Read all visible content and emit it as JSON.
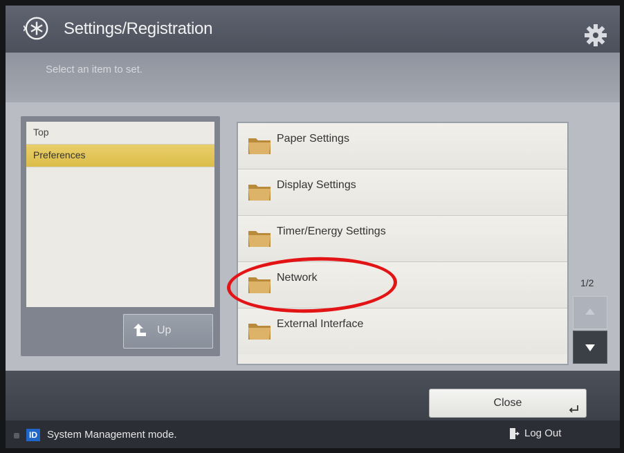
{
  "header": {
    "title": "Settings/Registration",
    "icon": "settings-registration-icon",
    "gear_icon": "gear-icon"
  },
  "instruction": "Select an item to set.",
  "left_panel": {
    "crumbs": [
      {
        "label": "Top",
        "selected": false
      },
      {
        "label": "Preferences",
        "selected": true
      }
    ],
    "up_button": "Up"
  },
  "items": [
    {
      "label": "Paper Settings",
      "icon": "folder-icon"
    },
    {
      "label": "Display Settings",
      "icon": "folder-icon"
    },
    {
      "label": "Timer/Energy Settings",
      "icon": "folder-icon"
    },
    {
      "label": "Network",
      "icon": "folder-icon",
      "annotated": true
    },
    {
      "label": "External Interface",
      "icon": "folder-icon"
    }
  ],
  "pager": {
    "page": "1/2"
  },
  "footer": {
    "close_label": "Close",
    "status_badge": "ID",
    "status_text": "System Management mode.",
    "logout_label": "Log Out"
  },
  "colors": {
    "selected_highlight": "#e2c55a",
    "annotation": "#e31416",
    "id_badge": "#1f66c6"
  }
}
